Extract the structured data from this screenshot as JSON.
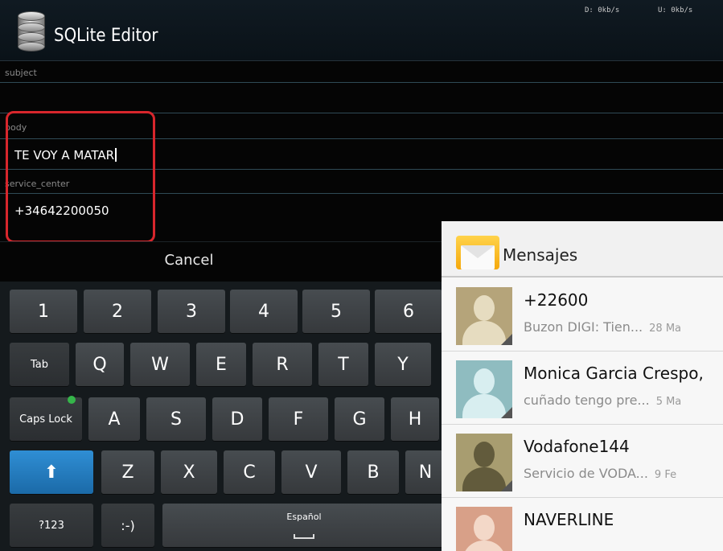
{
  "app": {
    "title": "SQLite Editor"
  },
  "status": {
    "download": "D: 0kb/s",
    "upload": "U: 0kb/s"
  },
  "fields": {
    "subject": {
      "label": "subject",
      "value": ""
    },
    "body": {
      "label": "body",
      "value": "TE VOY A MATAR"
    },
    "service_center": {
      "label": "service_center",
      "value": "+34642200050"
    }
  },
  "cancel_label": "Cancel",
  "keyboard": {
    "numbers": [
      "1",
      "2",
      "3",
      "4",
      "5",
      "6"
    ],
    "row_q": {
      "tab": "Tab",
      "keys": [
        "Q",
        "W",
        "E",
        "R",
        "T",
        "Y"
      ]
    },
    "row_a": {
      "caps": "Caps Lock",
      "keys": [
        "A",
        "S",
        "D",
        "F",
        "G",
        "H"
      ]
    },
    "row_z": {
      "shift": "⬆",
      "keys": [
        "Z",
        "X",
        "C",
        "V",
        "B",
        "N"
      ]
    },
    "row_bottom": {
      "symbols": "?123",
      "emoticon": ":-)",
      "space": "Español"
    }
  },
  "messages": {
    "title": "Mensajes",
    "items": [
      {
        "name": "+22600",
        "snippet": "Buzon DIGI: Tien...",
        "date": "28 Ma",
        "avatar_color": "#b5a47a"
      },
      {
        "name": "Monica Garcia Crespo,",
        "snippet": "cuñado tengo pre...",
        "date": "5 Ma",
        "avatar_color": "#8fbcc0"
      },
      {
        "name": "Vodafone144",
        "snippet": "Servicio de VODA...",
        "date": "9 Fe",
        "avatar_color": "#a89d70"
      },
      {
        "name": "NAVERLINE",
        "snippet": "",
        "date": "",
        "avatar_color": "#d8a088"
      }
    ]
  }
}
